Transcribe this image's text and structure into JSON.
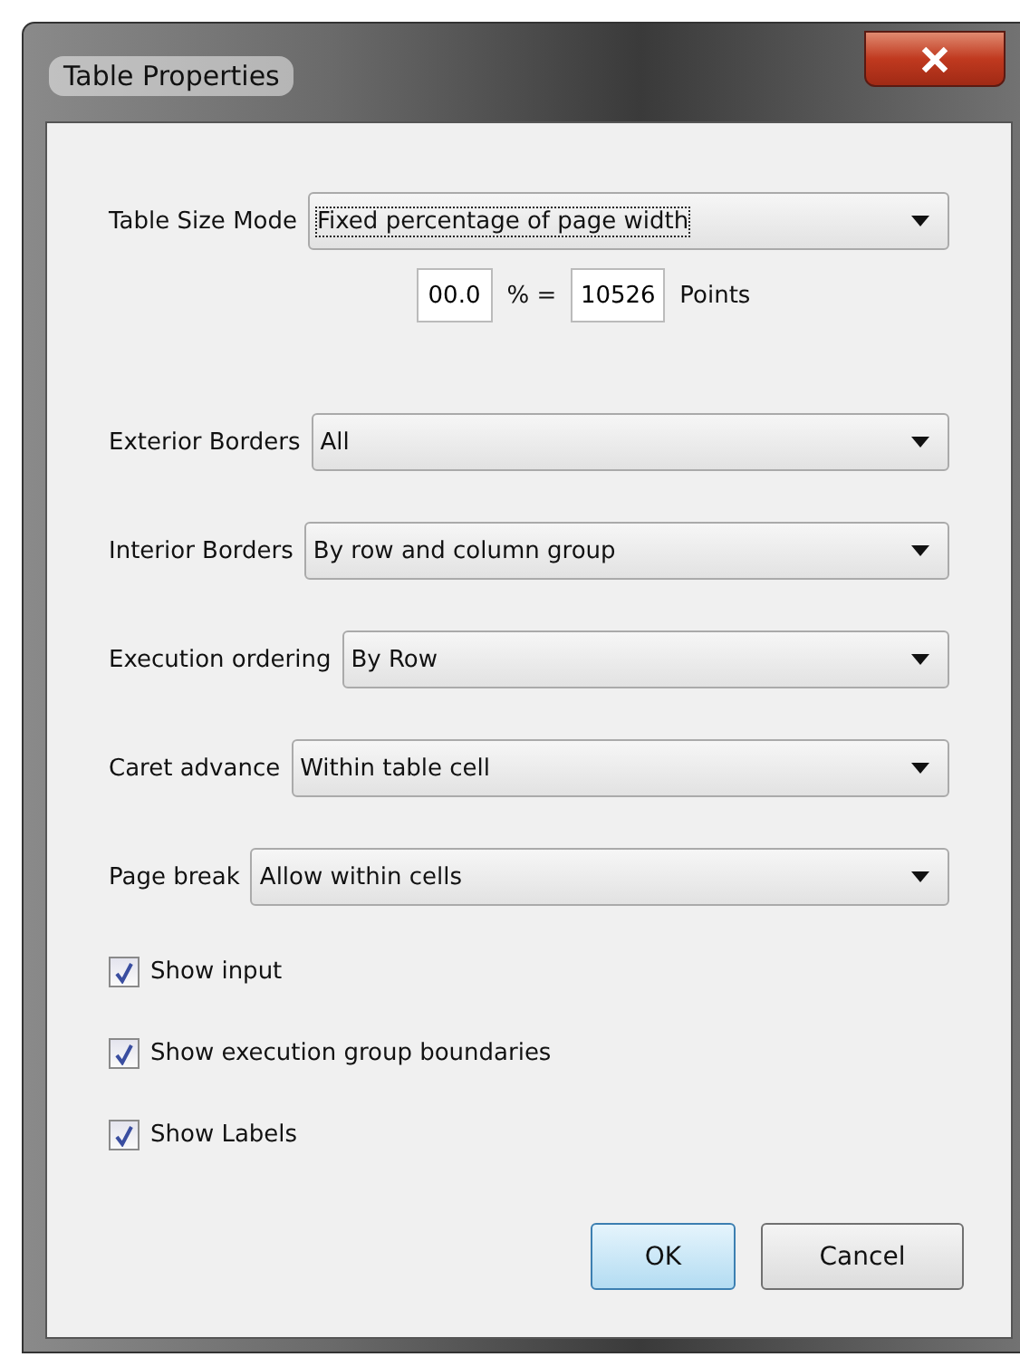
{
  "window": {
    "title": "Table Properties"
  },
  "size_mode": {
    "label": "Table Size Mode",
    "value": "Fixed percentage of page width",
    "focused": true
  },
  "size_row": {
    "percent": "00.0",
    "equals": "% =",
    "points": "10526",
    "unit": "Points"
  },
  "dropdowns": [
    {
      "label": "Exterior Borders",
      "value": "All"
    },
    {
      "label": "Interior Borders",
      "value": "By row and column group"
    },
    {
      "label": "Execution ordering",
      "value": "By Row"
    },
    {
      "label": "Caret advance",
      "value": "Within table cell"
    },
    {
      "label": "Page break",
      "value": "Allow within cells"
    }
  ],
  "checkboxes": [
    {
      "label": "Show input",
      "checked": true
    },
    {
      "label": "Show execution group boundaries",
      "checked": true
    },
    {
      "label": "Show Labels",
      "checked": true
    }
  ],
  "buttons": [
    {
      "label": "OK",
      "default": true
    },
    {
      "label": "Cancel",
      "default": false
    }
  ]
}
